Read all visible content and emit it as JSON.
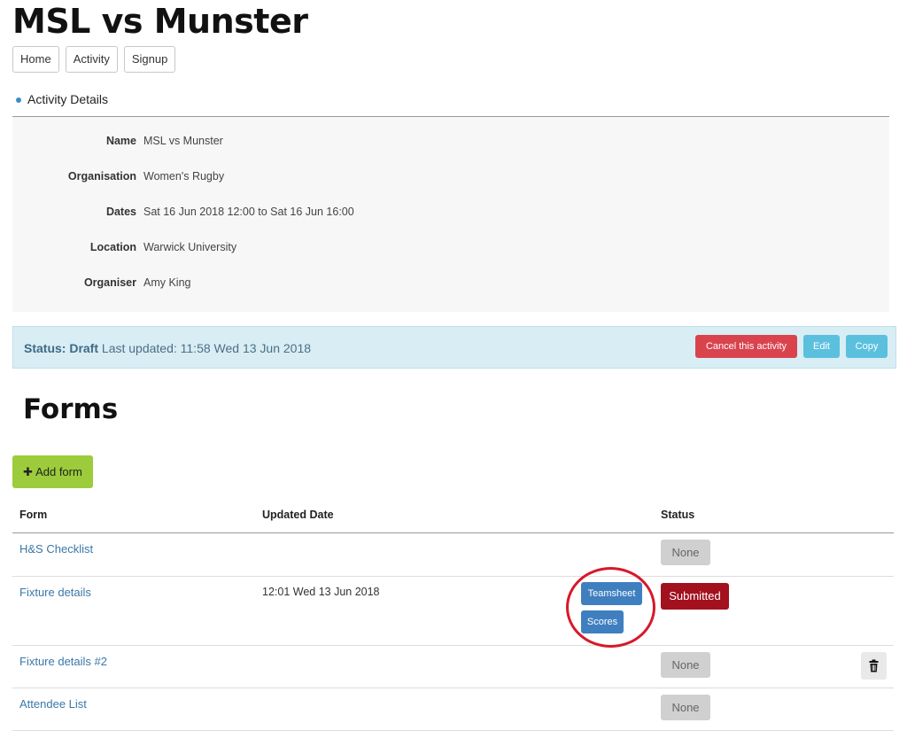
{
  "page": {
    "title": "MSL vs Munster"
  },
  "nav": {
    "home": "Home",
    "activity": "Activity",
    "signup": "Signup"
  },
  "details": {
    "heading": "Activity Details",
    "rows": [
      {
        "label": "Name",
        "value": "MSL vs Munster"
      },
      {
        "label": "Organisation",
        "value": "Women's Rugby"
      },
      {
        "label": "Dates",
        "value": "Sat 16 Jun 2018 12:00 to Sat 16 Jun 16:00"
      },
      {
        "label": "Location",
        "value": "Warwick University"
      },
      {
        "label": "Organiser",
        "value": "Amy King"
      }
    ]
  },
  "status": {
    "label": "Status: Draft",
    "updated": "Last updated: 11:58 Wed 13 Jun 2018",
    "cancel_label": "Cancel this activity",
    "edit_label": "Edit",
    "copy_label": "Copy",
    "colors": {
      "cancel": "#d9434e",
      "info": "#5bc0de",
      "bar": "#d9edf5"
    }
  },
  "forms": {
    "title": "Forms",
    "add_label": "Add form",
    "add_icon": "plus-icon",
    "columns": {
      "form": "Form",
      "updated": "Updated Date",
      "status": "Status"
    },
    "rows": [
      {
        "name": "H&S Checklist",
        "updated": "",
        "status": "None"
      },
      {
        "name": "Fixture details",
        "updated": "12:01 Wed 13 Jun 2018",
        "status": "Submitted",
        "actions": [
          "Teamsheet",
          "Scores"
        ]
      },
      {
        "name": "Fixture details #2",
        "updated": "",
        "status": "None",
        "delete_icon": "trash-icon"
      },
      {
        "name": "Attendee List",
        "updated": "",
        "status": "None"
      }
    ]
  }
}
